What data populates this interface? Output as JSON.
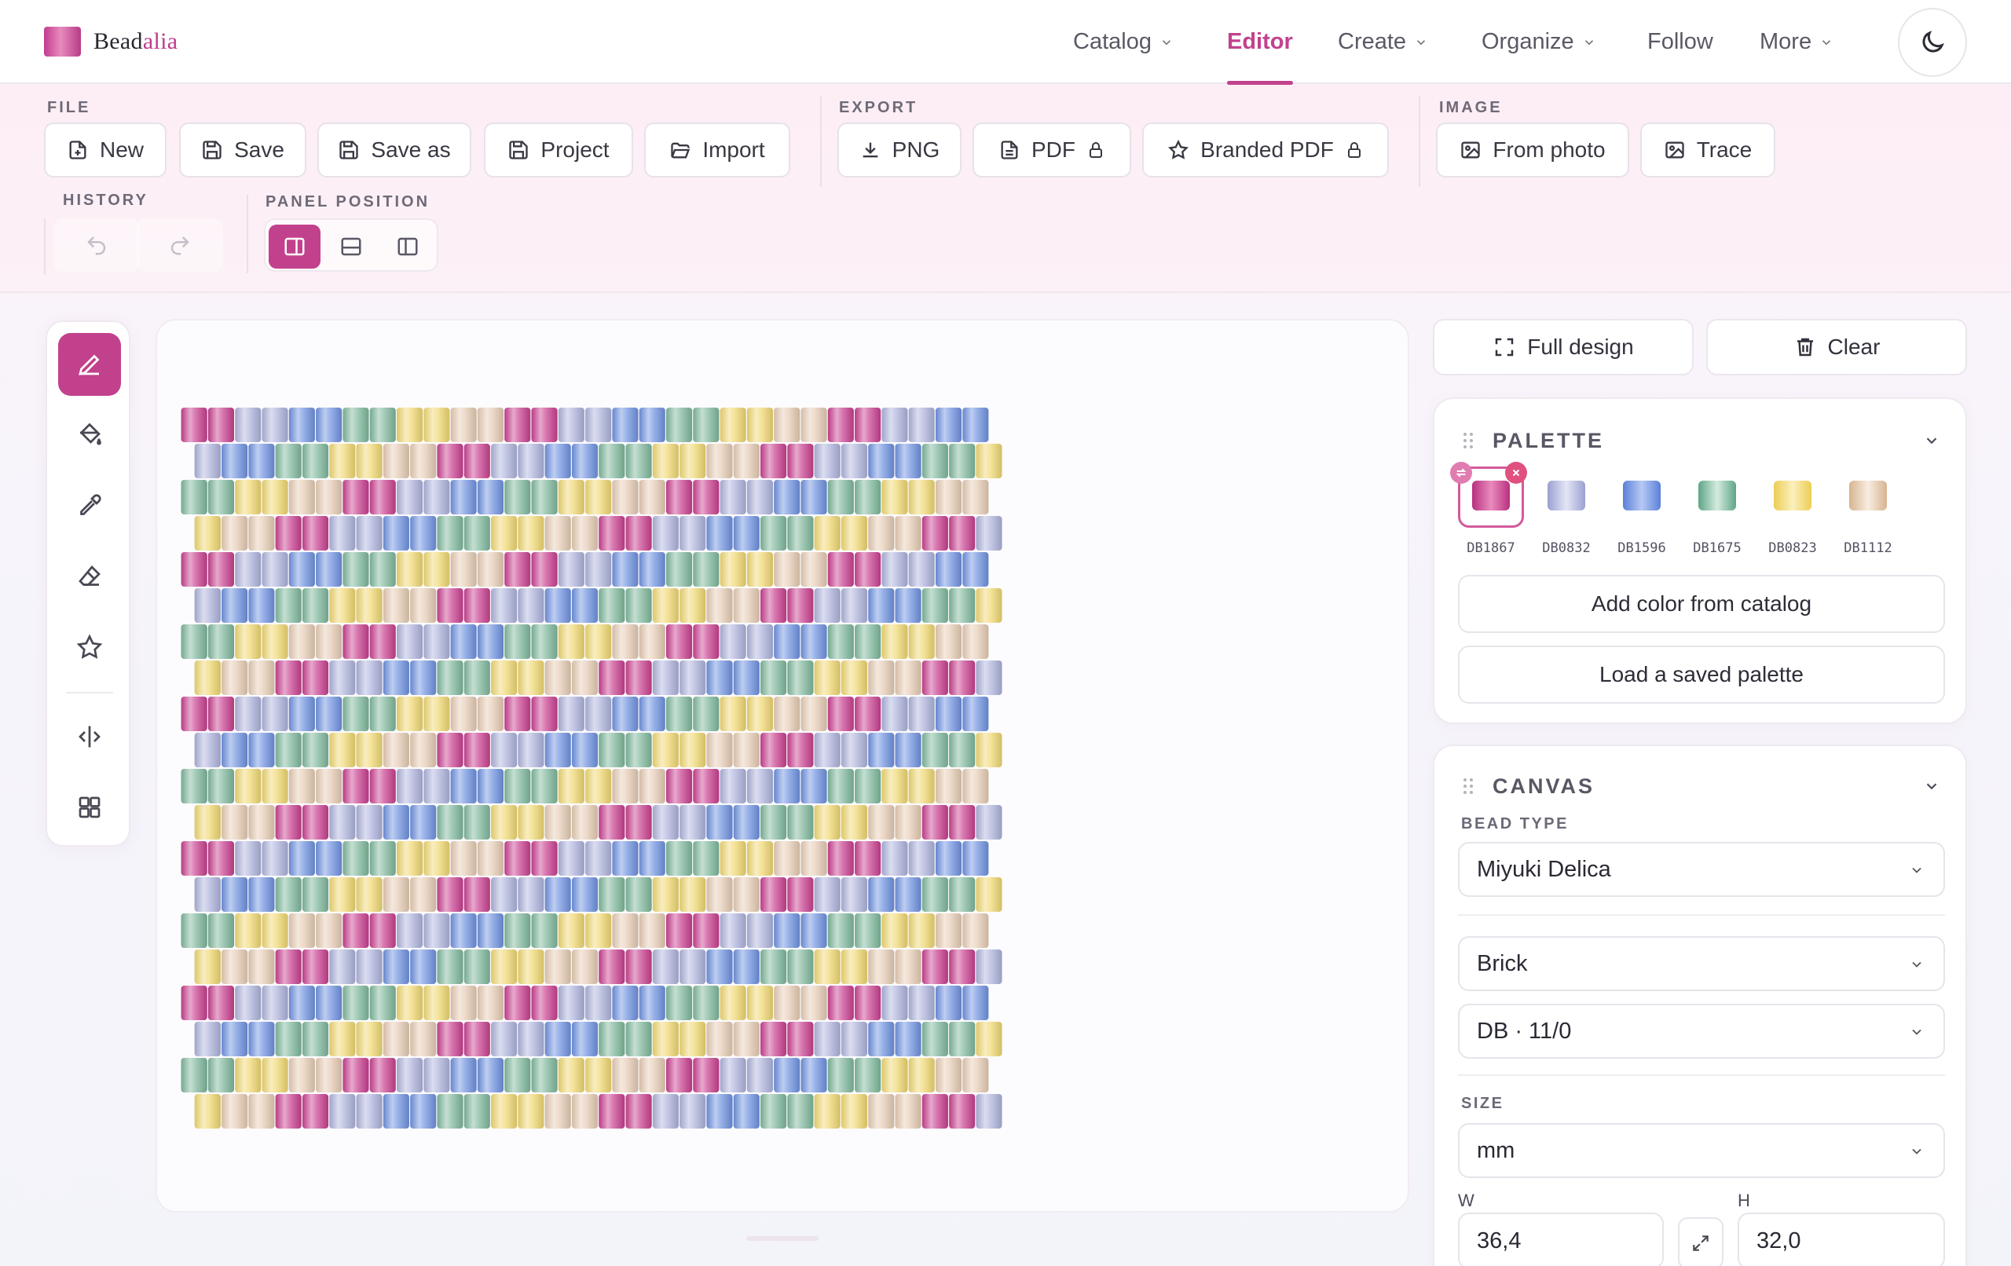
{
  "brand": {
    "name_part1": "Bead",
    "name_part2": "alia",
    "logo_colors": [
      "#c23c8d",
      "#e78bbd"
    ]
  },
  "nav": {
    "items": [
      {
        "label": "Catalog",
        "dropdown": true
      },
      {
        "label": "Editor",
        "active": true
      },
      {
        "label": "Create",
        "dropdown": true
      },
      {
        "label": "Organize",
        "dropdown": true
      },
      {
        "label": "Follow"
      },
      {
        "label": "More",
        "dropdown": true
      }
    ],
    "theme_icon": "moon-icon",
    "accent_color": "#c2418c"
  },
  "toolbar": {
    "file": {
      "label": "FILE",
      "buttons": [
        "New",
        "Save",
        "Save as",
        "Project",
        "Import"
      ]
    },
    "export": {
      "label": "EXPORT",
      "buttons": [
        "PNG",
        "PDF",
        "Branded PDF"
      ]
    },
    "image": {
      "label": "IMAGE",
      "buttons": [
        "From photo",
        "Trace"
      ]
    },
    "history": {
      "label": "HISTORY"
    },
    "panel_position": {
      "label": "PANEL POSITION",
      "selected": "right"
    }
  },
  "tools": [
    "pencil-icon",
    "fill-bucket-icon",
    "eyedropper-icon",
    "eraser-icon",
    "star-icon",
    "mirror-icon",
    "grid-icon"
  ],
  "canvas": {
    "palette_colors": {
      "DB1867": "#c9408f",
      "DB0832": "#aeb3dc",
      "DB1596": "#6f92e0",
      "DB1675": "#7fb89c",
      "DB0823": "#f0d872",
      "DB1112": "#e6ccb4"
    },
    "pattern_sequence": [
      "DB1867",
      "DB0832",
      "DB1596",
      "DB1675",
      "DB0823",
      "DB1112"
    ]
  },
  "right_panel": {
    "full_design_label": "Full design",
    "clear_label": "Clear",
    "palette": {
      "title": "PALETTE",
      "swatches": [
        "DB1867",
        "DB0832",
        "DB1596",
        "DB1675",
        "DB0823",
        "DB1112"
      ],
      "selected": "DB1867",
      "add_color_label": "Add color from catalog",
      "load_palette_label": "Load a saved palette"
    },
    "canvas": {
      "title": "CANVAS",
      "bead_type_label": "BEAD TYPE",
      "bead_type": "Miyuki Delica",
      "stitch": "Brick",
      "bead_size": "DB · 11/0",
      "size_label": "SIZE",
      "unit": "mm",
      "w_label": "W",
      "h_label": "H",
      "width": "36,4",
      "height": "32,0"
    }
  }
}
